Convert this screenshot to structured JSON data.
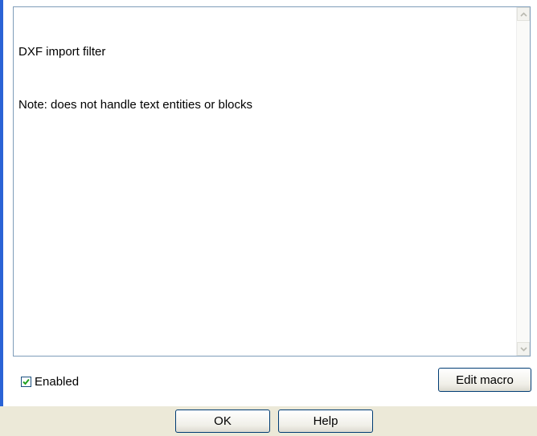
{
  "text_area": {
    "lines": [
      "DXF import filter",
      "Note: does not handle text entities or blocks"
    ]
  },
  "scrollbar": {
    "up_icon": "chevron-up-icon",
    "down_icon": "chevron-down-icon"
  },
  "enabled": {
    "label": "Enabled",
    "checked": true
  },
  "buttons": {
    "edit_macro": "Edit macro",
    "ok": "OK",
    "help": "Help"
  },
  "colors": {
    "accent_edge": "#2a63d6",
    "button_border": "#003c74",
    "checkmark": "#21a121",
    "dialog_bg": "#ece9d8"
  }
}
